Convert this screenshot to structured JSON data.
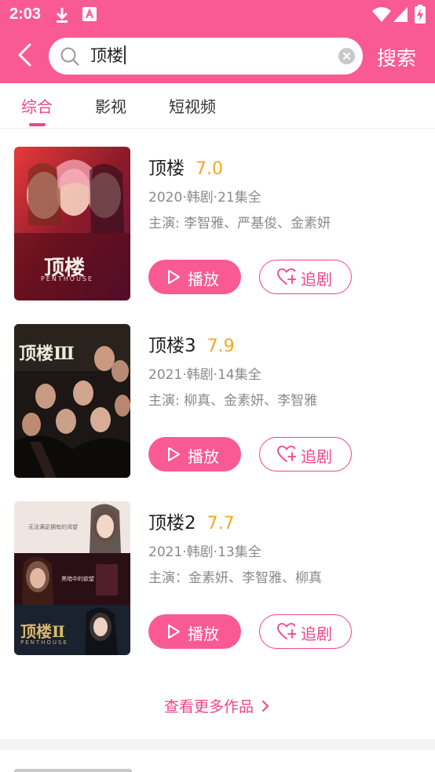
{
  "status_bar": {
    "time": "2:03",
    "icons": [
      "download-icon",
      "app-notification-icon",
      "wifi-icon",
      "signal-icon",
      "battery-charging-icon"
    ]
  },
  "search": {
    "query": "顶楼",
    "button_label": "搜索",
    "icons": [
      "back-arrow-icon",
      "search-icon",
      "clear-icon"
    ]
  },
  "tabs": [
    {
      "label": "综合",
      "active": true
    },
    {
      "label": "影视",
      "active": false
    },
    {
      "label": "短视频",
      "active": false
    }
  ],
  "results": [
    {
      "title": "顶楼",
      "score": "7.0",
      "meta": "2020·韩剧·21集全",
      "cast": "主演: 李智雅、严基俊、金素妍",
      "play_label": "播放",
      "follow_label": "追剧"
    },
    {
      "title": "顶楼3",
      "score": "7.9",
      "meta": "2021·韩剧·14集全",
      "cast": "主演: 柳真、金素妍、李智雅",
      "play_label": "播放",
      "follow_label": "追剧"
    },
    {
      "title": "顶楼2",
      "score": "7.7",
      "meta": "2021·韩剧·13集全",
      "cast": "主演：金素妍、李智雅、柳真",
      "play_label": "播放",
      "follow_label": "追剧"
    }
  ],
  "posters": [
    {
      "logo_text": "顶楼",
      "subtitle": "PENTHOUSE"
    },
    {
      "logo_text": "顶楼Ⅲ"
    },
    {
      "logo_text": "顶楼Ⅱ",
      "subtitle": "PENTHOUSE",
      "caption_top": "无法满足拥有的渴望",
      "caption_mid": "黑暗中的欲望"
    }
  ],
  "more_label": "查看更多作品",
  "colors": {
    "brand": "#fa5a93",
    "accent": "#f0448a",
    "score": "#f6a623"
  }
}
